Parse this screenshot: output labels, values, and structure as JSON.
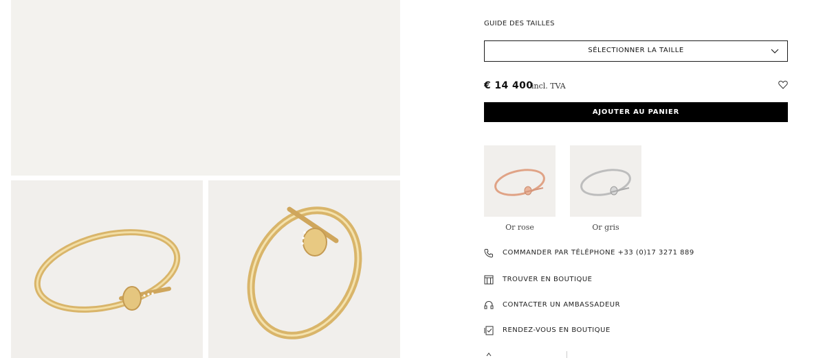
{
  "gallery": {
    "background_main": "#f3f2ee",
    "background_small": "#f1efec",
    "metal_color": "#e2c27a"
  },
  "size": {
    "guide_label": "GUIDE DES TAILLES",
    "select_label": "SÉLECTIONNER LA TAILLE"
  },
  "price": {
    "amount": "€ 14 400",
    "vat": "incl. TVA"
  },
  "cart": {
    "add_label": "AJOUTER AU PANIER"
  },
  "variants": [
    {
      "name": "Or rose",
      "color": "#e6a98c"
    },
    {
      "name": "Or gris",
      "color": "#c7c7c7"
    }
  ],
  "actions": [
    {
      "label": "COMMANDER PAR TÉLÉPHONE +33 (0)17 3271 889",
      "icon": "phone-icon"
    },
    {
      "label": "TROUVER EN BOUTIQUE",
      "icon": "store-icon"
    },
    {
      "label": "CONTACTER UN AMBASSADEUR",
      "icon": "headset-icon"
    },
    {
      "label": "RENDEZ-VOUS EN BOUTIQUE",
      "icon": "calendar-check-icon"
    }
  ]
}
